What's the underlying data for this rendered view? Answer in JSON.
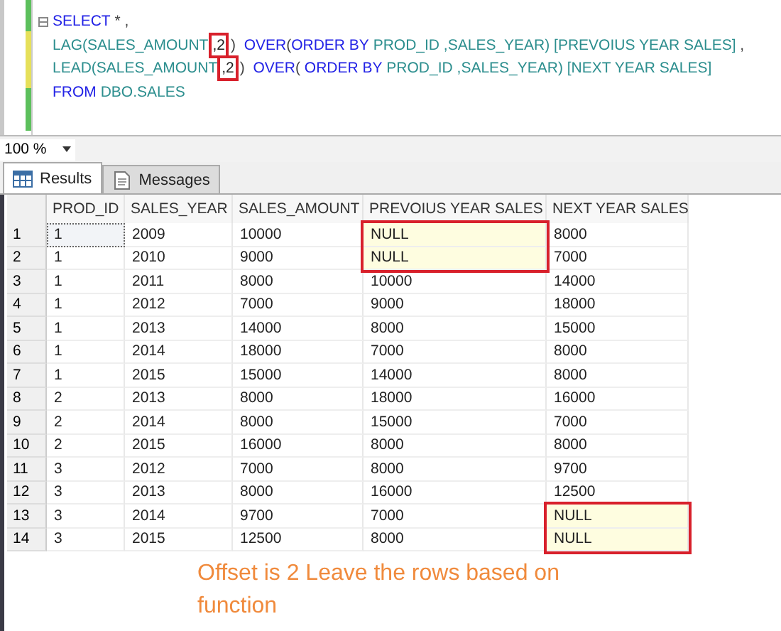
{
  "editor": {
    "lines": [
      {
        "collapse": true,
        "tokens": [
          {
            "text": "SELECT",
            "kind": "keyword"
          },
          {
            "text": " * ,",
            "kind": "plain"
          }
        ]
      },
      {
        "collapse": false,
        "tokens": [
          {
            "text": "LAG(SALES_AMOUNT",
            "kind": "name"
          },
          {
            "text": ",2",
            "kind": "offset"
          },
          {
            "text": ")  ",
            "kind": "plain"
          },
          {
            "text": "OVER",
            "kind": "keyword"
          },
          {
            "text": "(",
            "kind": "plain"
          },
          {
            "text": "ORDER BY",
            "kind": "keyword"
          },
          {
            "text": " PROD_ID ,SALES_YEAR) [PREVOIUS YEAR SALES]",
            "kind": "name"
          },
          {
            "text": " ,",
            "kind": "plain"
          }
        ]
      },
      {
        "collapse": false,
        "tokens": [
          {
            "text": "LEAD(SALES_AMOUNT",
            "kind": "name"
          },
          {
            "text": ",2",
            "kind": "offset"
          },
          {
            "text": ")  ",
            "kind": "plain"
          },
          {
            "text": "OVER",
            "kind": "keyword"
          },
          {
            "text": "( ",
            "kind": "plain"
          },
          {
            "text": "ORDER BY",
            "kind": "keyword"
          },
          {
            "text": " PROD_ID ,SALES_YEAR) [NEXT YEAR SALES]",
            "kind": "name"
          }
        ]
      },
      {
        "collapse": false,
        "tokens": [
          {
            "text": "FROM",
            "kind": "keyword"
          },
          {
            "text": " DBO.SALES",
            "kind": "name"
          }
        ]
      }
    ]
  },
  "zoom": {
    "value": "100 %"
  },
  "tabs": [
    {
      "label": "Results",
      "selected": true
    },
    {
      "label": "Messages",
      "selected": false
    }
  ],
  "grid": {
    "columns": [
      "PROD_ID",
      "SALES_YEAR",
      "SALES_AMOUNT",
      "PREVOIUS YEAR SALES",
      "NEXT YEAR SALES"
    ],
    "rows": [
      {
        "number": "1",
        "cells": [
          "1",
          "2009",
          "10000",
          "NULL",
          "8000"
        ],
        "highlighted": [
          false,
          false,
          false,
          true,
          false
        ]
      },
      {
        "number": "2",
        "cells": [
          "1",
          "2010",
          "9000",
          "NULL",
          "7000"
        ],
        "highlighted": [
          false,
          false,
          false,
          true,
          false
        ]
      },
      {
        "number": "3",
        "cells": [
          "1",
          "2011",
          "8000",
          "10000",
          "14000"
        ],
        "highlighted": [
          false,
          false,
          false,
          false,
          false
        ]
      },
      {
        "number": "4",
        "cells": [
          "1",
          "2012",
          "7000",
          "9000",
          "18000"
        ],
        "highlighted": [
          false,
          false,
          false,
          false,
          false
        ]
      },
      {
        "number": "5",
        "cells": [
          "1",
          "2013",
          "14000",
          "8000",
          "15000"
        ],
        "highlighted": [
          false,
          false,
          false,
          false,
          false
        ]
      },
      {
        "number": "6",
        "cells": [
          "1",
          "2014",
          "18000",
          "7000",
          "8000"
        ],
        "highlighted": [
          false,
          false,
          false,
          false,
          false
        ]
      },
      {
        "number": "7",
        "cells": [
          "1",
          "2015",
          "15000",
          "14000",
          "8000"
        ],
        "highlighted": [
          false,
          false,
          false,
          false,
          false
        ]
      },
      {
        "number": "8",
        "cells": [
          "2",
          "2013",
          "8000",
          "18000",
          "16000"
        ],
        "highlighted": [
          false,
          false,
          false,
          false,
          false
        ]
      },
      {
        "number": "9",
        "cells": [
          "2",
          "2014",
          "8000",
          "15000",
          "7000"
        ],
        "highlighted": [
          false,
          false,
          false,
          false,
          false
        ]
      },
      {
        "number": "10",
        "cells": [
          "2",
          "2015",
          "16000",
          "8000",
          "8000"
        ],
        "highlighted": [
          false,
          false,
          false,
          false,
          false
        ]
      },
      {
        "number": "11",
        "cells": [
          "3",
          "2012",
          "7000",
          "8000",
          "9700"
        ],
        "highlighted": [
          false,
          false,
          false,
          false,
          false
        ]
      },
      {
        "number": "12",
        "cells": [
          "3",
          "2013",
          "8000",
          "16000",
          "12500"
        ],
        "highlighted": [
          false,
          false,
          false,
          false,
          false
        ]
      },
      {
        "number": "13",
        "cells": [
          "3",
          "2014",
          "9700",
          "7000",
          "NULL"
        ],
        "highlighted": [
          false,
          false,
          false,
          false,
          true
        ]
      },
      {
        "number": "14",
        "cells": [
          "3",
          "2015",
          "12500",
          "8000",
          "NULL"
        ],
        "highlighted": [
          false,
          false,
          false,
          false,
          true
        ]
      }
    ]
  },
  "caption": "Offset is 2 Leave the rows based on function"
}
